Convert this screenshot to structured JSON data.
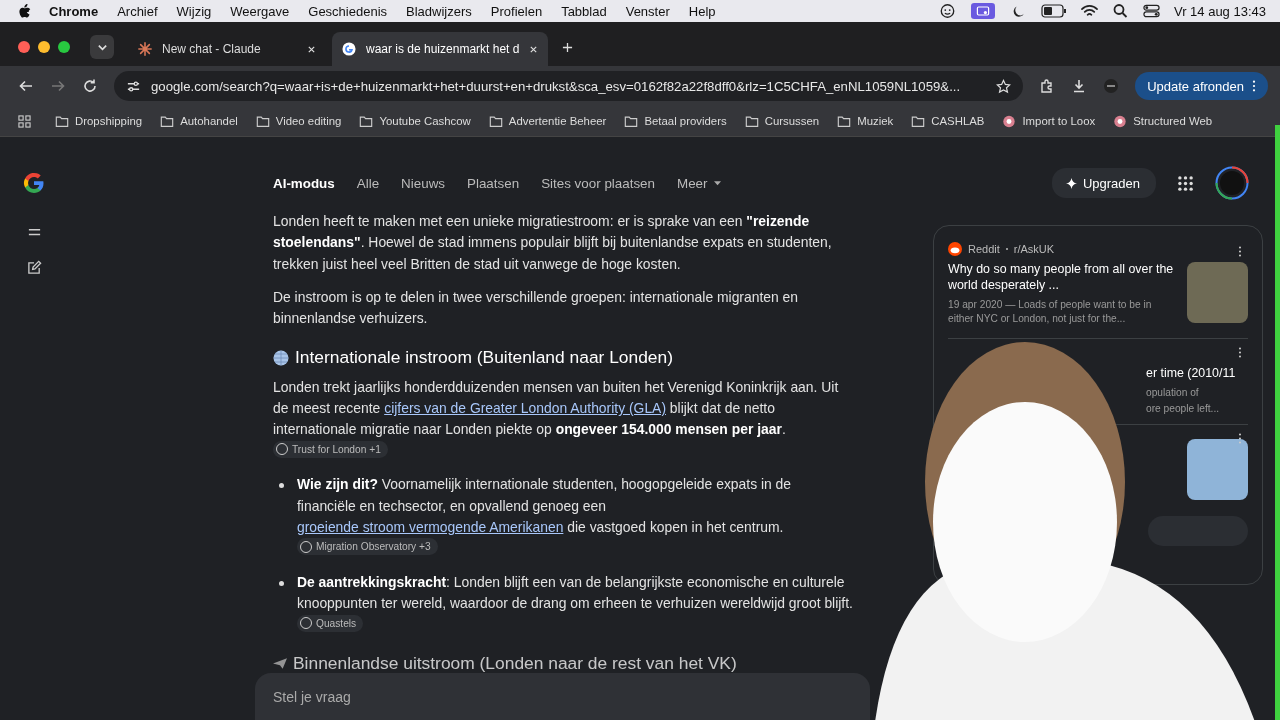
{
  "menubar": {
    "app": "Chrome",
    "menus": [
      "Archief",
      "Wijzig",
      "Weergave",
      "Geschiedenis",
      "Bladwijzers",
      "Profielen",
      "Tabblad",
      "Venster",
      "Help"
    ],
    "clock": "Vr 14 aug  13:43"
  },
  "tabs": [
    {
      "title": "New chat - Claude",
      "kind": "claude",
      "selected": false
    },
    {
      "title": "waar is de huizenmarkt het d",
      "kind": "google",
      "selected": true
    }
  ],
  "address": {
    "url": "google.com/search?q=waar+is+de+huizenmarkt+het+duurst+en+drukst&sca_esv=0162f82a22f8dff0&rlz=1C5CHFA_enNL1059NL1059&..."
  },
  "update_button": "Update afronden",
  "bookmarks": [
    {
      "label": "Dropshipping",
      "kind": "folder"
    },
    {
      "label": "Autohandel",
      "kind": "folder"
    },
    {
      "label": "Video editing",
      "kind": "folder"
    },
    {
      "label": "Youtube Cashcow",
      "kind": "folder"
    },
    {
      "label": "Advertentie Beheer",
      "kind": "folder"
    },
    {
      "label": "Betaal providers",
      "kind": "folder"
    },
    {
      "label": "Cursussen",
      "kind": "folder"
    },
    {
      "label": "Muziek",
      "kind": "folder"
    },
    {
      "label": "CASHLAB",
      "kind": "folder"
    },
    {
      "label": "Import to Loox",
      "kind": "site"
    },
    {
      "label": "Structured Web",
      "kind": "site"
    }
  ],
  "search_nav": [
    {
      "label": "AI-modus",
      "selected": true
    },
    {
      "label": "Alle",
      "selected": false
    },
    {
      "label": "Nieuws",
      "selected": false
    },
    {
      "label": "Plaatsen",
      "selected": false
    },
    {
      "label": "Sites voor plaatsen",
      "selected": false
    }
  ],
  "more_menu": "Meer",
  "upgrade_button": "Upgraden",
  "content": [
    {
      "kind": "paragraph",
      "parts": [
        {
          "kind": "text",
          "text": "Londen heeft te maken met een unieke migratiestroom: er is sprake van een **\"reizende stoelendans\"**. Hoewel de stad immens populair blijft bij buitenlandse expats en studenten, trekken juist heel veel Britten de stad uit vanwege de hoge kosten."
        }
      ]
    },
    {
      "kind": "paragraph",
      "parts": [
        {
          "kind": "text",
          "text": "De instroom is op te delen in twee verschillende groepen: internationale migranten en binnenlandse verhuizers."
        }
      ]
    },
    {
      "kind": "heading",
      "text": "Internationale instroom (Buitenland naar Londen)"
    },
    {
      "kind": "paragraph",
      "parts": [
        {
          "kind": "text",
          "text": "Londen trekt jaarlijks honderdduizenden mensen van buiten het Verenigd Koninkrijk aan. Uit de meest recente "
        },
        {
          "kind": "link",
          "text": "cijfers van de Greater London Authority (GLA)"
        },
        {
          "kind": "text",
          "text": " blijkt dat de netto internationale migratie naar Londen piekte op **ongeveer 154.000 mensen per jaar**. "
        },
        {
          "kind": "chip",
          "text": "Trust for London +1"
        }
      ]
    },
    {
      "kind": "bullets",
      "items": [
        {
          "parts": [
            {
              "kind": "text",
              "text": "**Wie zijn dit?** Voornamelijk internationale studenten, hoogopgeleide expats in de financiële en techsector, en opvallend genoeg een "
            },
            {
              "kind": "link",
              "text": "groeiende stroom vermogende Amerikanen"
            },
            {
              "kind": "text",
              "text": " die vastgoed kopen in het centrum. "
            },
            {
              "kind": "chip",
              "text": "Migration Observatory +3"
            }
          ]
        },
        {
          "parts": [
            {
              "kind": "text",
              "text": "**De aantrekkingskracht**: Londen blijft een van de belangrijkste economische en culturele knooppunten ter wereld, waardoor de drang om erheen te verhuizen wereldwijd groot blijft. "
            },
            {
              "kind": "chip",
              "text": "Quastels"
            }
          ]
        }
      ]
    },
    {
      "kind": "faded_heading",
      "text": "Binnenlandse uitstroom (Londen naar de rest van het VK)"
    }
  ],
  "sources": [
    {
      "kind": "full",
      "site": "Reddit",
      "sub": "r/AskUK",
      "title": "Why do so many people from all over the world desperately ...",
      "snippet": "19 apr 2020 — Loads of people want to be in either NYC or London, not just for the..."
    },
    {
      "kind": "covered",
      "title": "er time (2010/11",
      "snippet_lines": [
        "opulation of",
        "ore people left..."
      ]
    },
    {
      "kind": "image_only"
    }
  ],
  "ask_field": {
    "placeholder": "Stel je vraag"
  }
}
